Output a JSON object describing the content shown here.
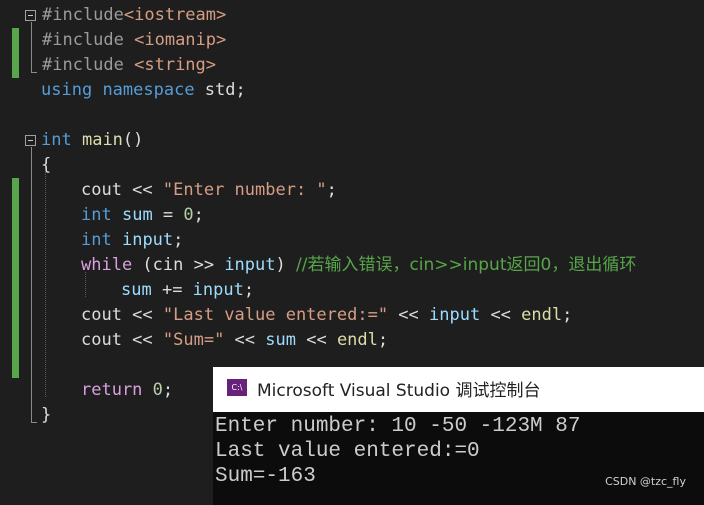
{
  "editor": {
    "lines": [
      {
        "id": "l1",
        "segs": [
          {
            "c": "pre",
            "t": "#include"
          },
          {
            "c": "inc",
            "t": "<iostream>"
          }
        ]
      },
      {
        "id": "l2",
        "segs": [
          {
            "c": "pre",
            "t": "#include "
          },
          {
            "c": "inc",
            "t": "<iomanip>"
          }
        ]
      },
      {
        "id": "l3",
        "segs": [
          {
            "c": "pre",
            "t": "#include "
          },
          {
            "c": "inc",
            "t": "<string>"
          }
        ]
      },
      {
        "id": "l4",
        "segs": [
          {
            "c": "kw-blue",
            "t": "using"
          },
          {
            "c": "plain",
            "t": " "
          },
          {
            "c": "kw-blue",
            "t": "namespace"
          },
          {
            "c": "plain",
            "t": " std;"
          }
        ]
      },
      {
        "id": "l5",
        "segs": []
      },
      {
        "id": "l6",
        "segs": [
          {
            "c": "kw-blue",
            "t": "int"
          },
          {
            "c": "plain",
            "t": " "
          },
          {
            "c": "fn",
            "t": "main"
          },
          {
            "c": "plain",
            "t": "()"
          }
        ]
      },
      {
        "id": "l7",
        "segs": [
          {
            "c": "plain",
            "t": "{"
          }
        ]
      },
      {
        "id": "l8",
        "segs": [
          {
            "c": "plain",
            "t": "cout << "
          },
          {
            "c": "str",
            "t": "\"Enter number: \""
          },
          {
            "c": "plain",
            "t": ";"
          }
        ]
      },
      {
        "id": "l9",
        "segs": [
          {
            "c": "kw-blue",
            "t": "int"
          },
          {
            "c": "plain",
            "t": " "
          },
          {
            "c": "var",
            "t": "sum"
          },
          {
            "c": "plain",
            "t": " = "
          },
          {
            "c": "num",
            "t": "0"
          },
          {
            "c": "plain",
            "t": ";"
          }
        ]
      },
      {
        "id": "l10",
        "segs": [
          {
            "c": "kw-blue",
            "t": "int"
          },
          {
            "c": "plain",
            "t": " "
          },
          {
            "c": "var",
            "t": "input"
          },
          {
            "c": "plain",
            "t": ";"
          }
        ]
      },
      {
        "id": "l11",
        "segs": [
          {
            "c": "kw-purple",
            "t": "while"
          },
          {
            "c": "plain",
            "t": " (cin >> "
          },
          {
            "c": "var",
            "t": "input"
          },
          {
            "c": "plain",
            "t": ") "
          },
          {
            "c": "cmt",
            "t": "//若输入错误，cin>>input返回0，退出循环"
          }
        ]
      },
      {
        "id": "l12",
        "segs": [
          {
            "c": "var",
            "t": "sum"
          },
          {
            "c": "plain",
            "t": " += "
          },
          {
            "c": "var",
            "t": "input"
          },
          {
            "c": "plain",
            "t": ";"
          }
        ]
      },
      {
        "id": "l13",
        "segs": [
          {
            "c": "plain",
            "t": "cout << "
          },
          {
            "c": "str",
            "t": "\"Last value entered:=\""
          },
          {
            "c": "plain",
            "t": " << "
          },
          {
            "c": "var",
            "t": "input"
          },
          {
            "c": "plain",
            "t": " << "
          },
          {
            "c": "fn",
            "t": "endl"
          },
          {
            "c": "plain",
            "t": ";"
          }
        ]
      },
      {
        "id": "l14",
        "segs": [
          {
            "c": "plain",
            "t": "cout << "
          },
          {
            "c": "str",
            "t": "\"Sum=\""
          },
          {
            "c": "plain",
            "t": " << "
          },
          {
            "c": "var",
            "t": "sum"
          },
          {
            "c": "plain",
            "t": " << "
          },
          {
            "c": "fn",
            "t": "endl"
          },
          {
            "c": "plain",
            "t": ";"
          }
        ]
      },
      {
        "id": "l15",
        "segs": []
      },
      {
        "id": "l16",
        "segs": [
          {
            "c": "kw-purple",
            "t": "return"
          },
          {
            "c": "plain",
            "t": " "
          },
          {
            "c": "num",
            "t": "0"
          },
          {
            "c": "plain",
            "t": ";"
          }
        ]
      },
      {
        "id": "l17",
        "segs": [
          {
            "c": "plain",
            "t": "}"
          }
        ]
      }
    ]
  },
  "console": {
    "icon_label": "C:\\",
    "title": "Microsoft Visual Studio 调试控制台",
    "output": [
      "Enter number: 10 -50 -123M 87",
      "Last value entered:=0",
      "Sum=-163"
    ]
  },
  "watermark": "CSDN @tzc_fly",
  "colors": {
    "background": "#1e1e1e",
    "change_bar": "#57a64a",
    "console_bg": "#0c0c0c",
    "vs_purple": "#68217a"
  }
}
